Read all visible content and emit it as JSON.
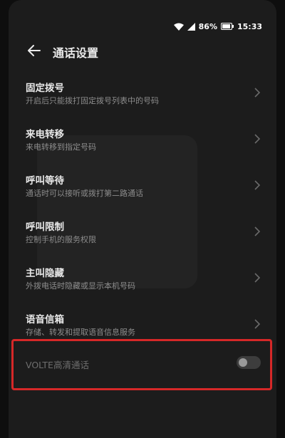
{
  "status_bar": {
    "battery": "86%",
    "time": "15:33"
  },
  "header": {
    "back_icon": "arrow-left-icon",
    "title": "通话设置"
  },
  "settings": [
    {
      "title": "固定拨号",
      "subtitle": "开启后只能拨打固定拨号列表中的号码"
    },
    {
      "title": "来电转移",
      "subtitle": "来电转移到指定号码"
    },
    {
      "title": "呼叫等待",
      "subtitle": "通话时可以接听或拨打第二路通话"
    },
    {
      "title": "呼叫限制",
      "subtitle": "控制手机的服务权限"
    },
    {
      "title": "主叫隐藏",
      "subtitle": "外拨电话时隐藏或显示本机号码"
    },
    {
      "title": "语音信箱",
      "subtitle": "存储、转发和提取语音信息服务"
    }
  ],
  "volte": {
    "label": "VOLTE高清通话",
    "enabled": false
  },
  "colors": {
    "highlight": "#d62828"
  }
}
